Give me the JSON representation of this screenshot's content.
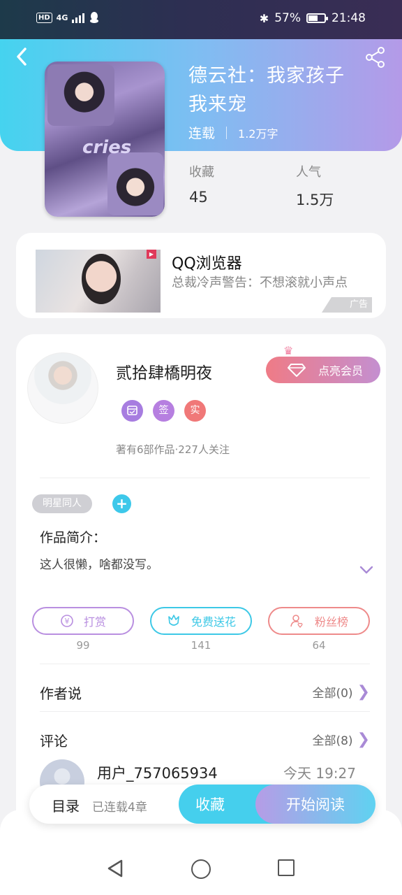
{
  "status_bar": {
    "left_icons": [
      "hd-icon",
      "4g-icon",
      "signal-icon",
      "qq-icon"
    ],
    "hd": "HD",
    "network": "4G",
    "battery_percent": "57%",
    "battery_level": 0.57,
    "time": "21:48"
  },
  "book": {
    "title": "德云社：我家孩子我来宠",
    "status": "连载",
    "word_count": "1.2万字",
    "favorites_label": "收藏",
    "favorites_value": "45",
    "popularity_label": "人气",
    "popularity_value": "1.5万",
    "cover_text": "cries"
  },
  "ad": {
    "title": "QQ浏览器",
    "description": "总裁冷声警告：不想滚就小声点",
    "badge": "广告"
  },
  "author": {
    "name": "贰拾肆橋明夜",
    "vip_button": "点亮会员",
    "badges": [
      {
        "text": "",
        "icon": "calendar-icon",
        "color": "#a77de0"
      },
      {
        "text": "签",
        "icon": "",
        "color": "#b67fe0"
      },
      {
        "text": "实",
        "icon": "",
        "color": "#f07878"
      }
    ],
    "works": "著有6部作品·227人关注"
  },
  "tags": [
    "明星同人"
  ],
  "intro": {
    "heading": "作品简介：",
    "text": "这人很懒，啥都没写。"
  },
  "actions": [
    {
      "label": "打赏",
      "count": "99",
      "color": "#b98fe0",
      "icon": "yen-icon"
    },
    {
      "label": "免费送花",
      "count": "141",
      "color": "#3dc8e6",
      "icon": "flower-icon"
    },
    {
      "label": "粉丝榜",
      "count": "64",
      "color": "#ee8a8a",
      "icon": "fan-icon"
    }
  ],
  "author_says": {
    "title": "作者说",
    "all": "全部(0)"
  },
  "comments": {
    "title": "评论",
    "all": "全部(8)",
    "items": [
      {
        "user": "用户_757065934",
        "time": "今天 19:27"
      }
    ]
  },
  "bottom_bar": {
    "catalog": "目录",
    "chapters": "已连载4章",
    "favorite": "收藏",
    "read": "开始阅读"
  },
  "colors": {
    "header_gradient_start": "#45d3ef",
    "header_gradient_end": "#b49ae8",
    "accent_purple": "#a98ad6",
    "accent_cyan": "#45cfed"
  }
}
